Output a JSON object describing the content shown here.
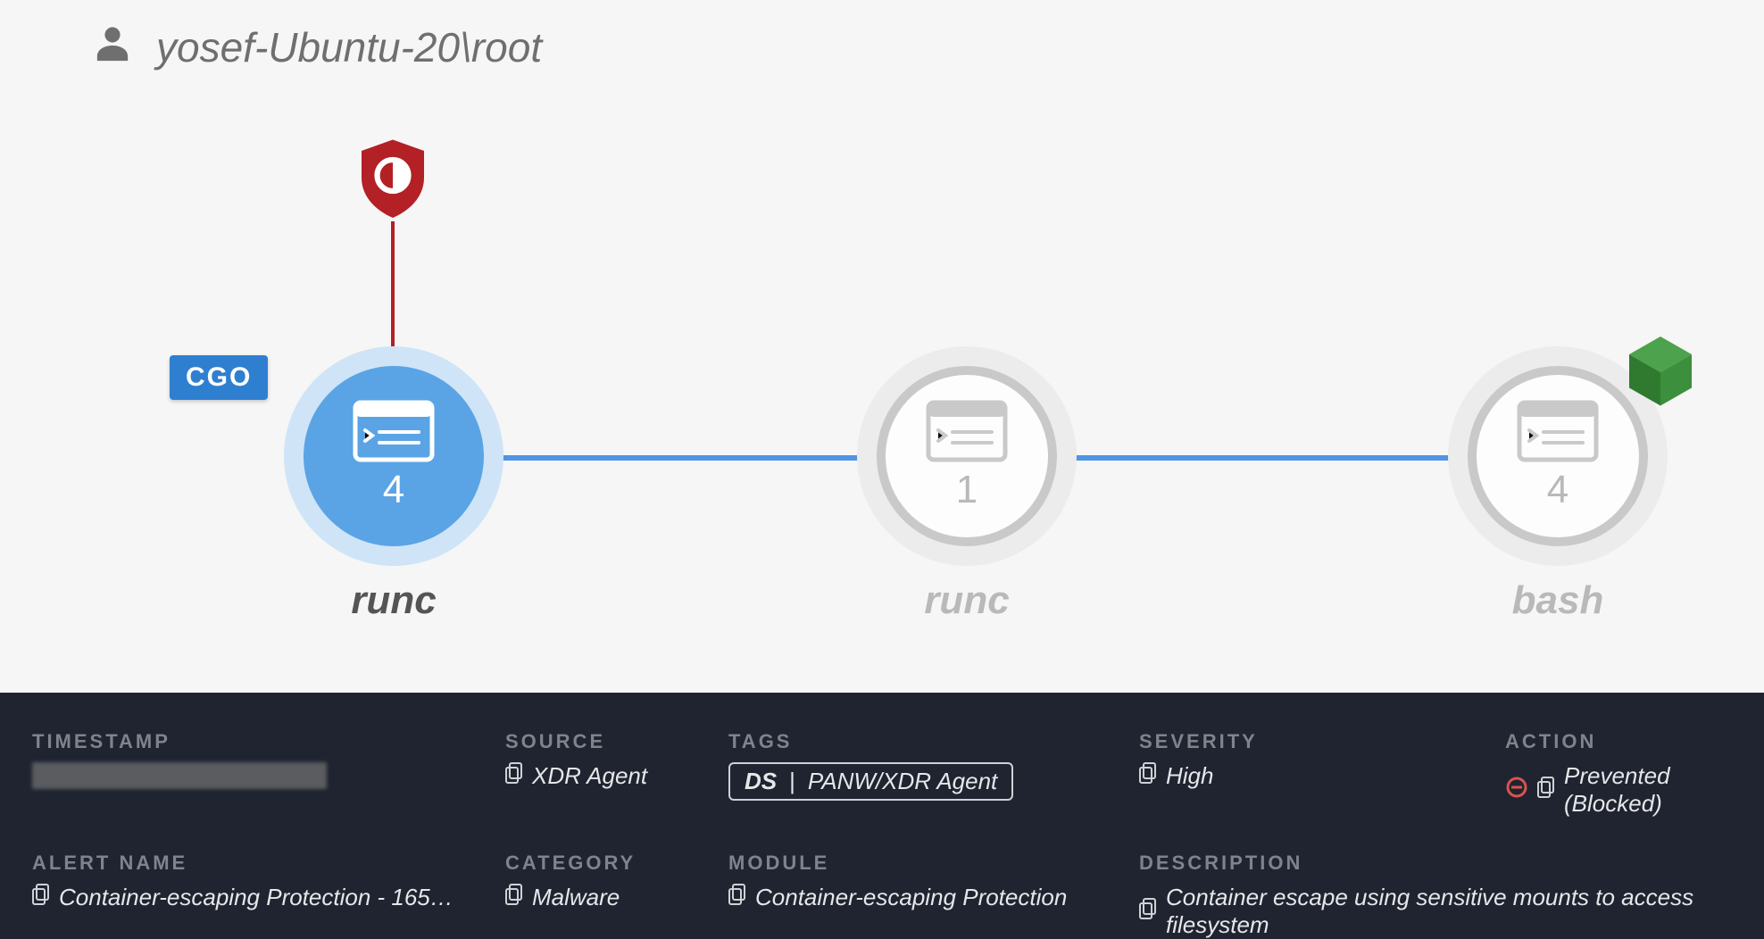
{
  "user": "yosef-Ubuntu-20\\root",
  "nodes": [
    {
      "id": "n1",
      "label": "runc",
      "count": "4",
      "active": true,
      "badge": "CGO",
      "shield": true
    },
    {
      "id": "n2",
      "label": "runc",
      "count": "1",
      "active": false
    },
    {
      "id": "n3",
      "label": "bash",
      "count": "4",
      "active": false,
      "cube": true
    }
  ],
  "details": {
    "timestamp_label": "TIMESTAMP",
    "source_label": "SOURCE",
    "source_value": "XDR Agent",
    "tags_label": "TAGS",
    "tags_ds": "DS",
    "tags_sep": "|",
    "tags_value": "PANW/XDR Agent",
    "severity_label": "SEVERITY",
    "severity_value": "High",
    "action_label": "ACTION",
    "action_value": "Prevented (Blocked)",
    "alertname_label": "ALERT NAME",
    "alertname_value": "Container-escaping Protection - 165…",
    "category_label": "CATEGORY",
    "category_value": "Malware",
    "module_label": "MODULE",
    "module_value": "Container-escaping Protection",
    "description_label": "DESCRIPTION",
    "description_value": "Container escape using sensitive mounts to access filesystem"
  }
}
